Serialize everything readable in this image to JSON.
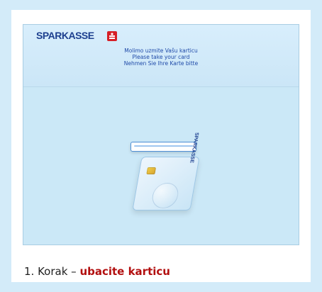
{
  "screen": {
    "brand": "SPARKASSE",
    "messages": [
      "Molimo uzmite Vašu karticu",
      "Please take your card",
      "Nehmen Sie Ihre Karte bitte"
    ],
    "card_brand": "SPARKASSE"
  },
  "caption": {
    "step": "1. Korak – ",
    "action": "ubacite karticu"
  },
  "colors": {
    "brand": "#1d3f8f",
    "caption_action": "#b20f0f",
    "screen_bg": "#cbe8f7"
  }
}
